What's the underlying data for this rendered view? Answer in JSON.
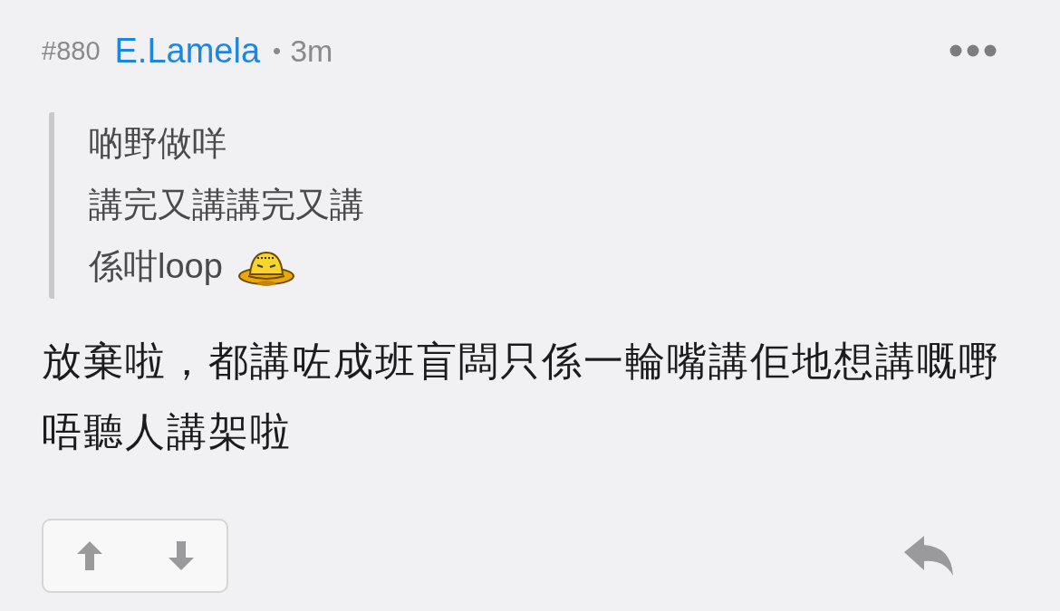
{
  "post": {
    "number": "#880",
    "author": "E.Lamela",
    "separator": "•",
    "time": "3m"
  },
  "quote": [
    "啲野做咩",
    "講完又講講完又講",
    "係咁loop"
  ],
  "body": "放棄啦，都講咗成班盲闆只係一輪嘴講佢地想講嘅嘢唔聽人講架啦"
}
